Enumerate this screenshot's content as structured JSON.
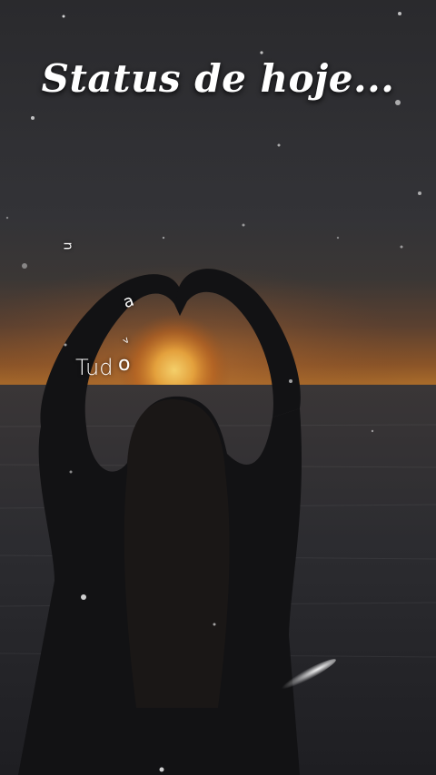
{
  "title": "Status de hoje...",
  "lyrics": {
    "word": "Tud",
    "o": "o",
    "u": "u",
    "a": "a",
    "v": "v"
  }
}
